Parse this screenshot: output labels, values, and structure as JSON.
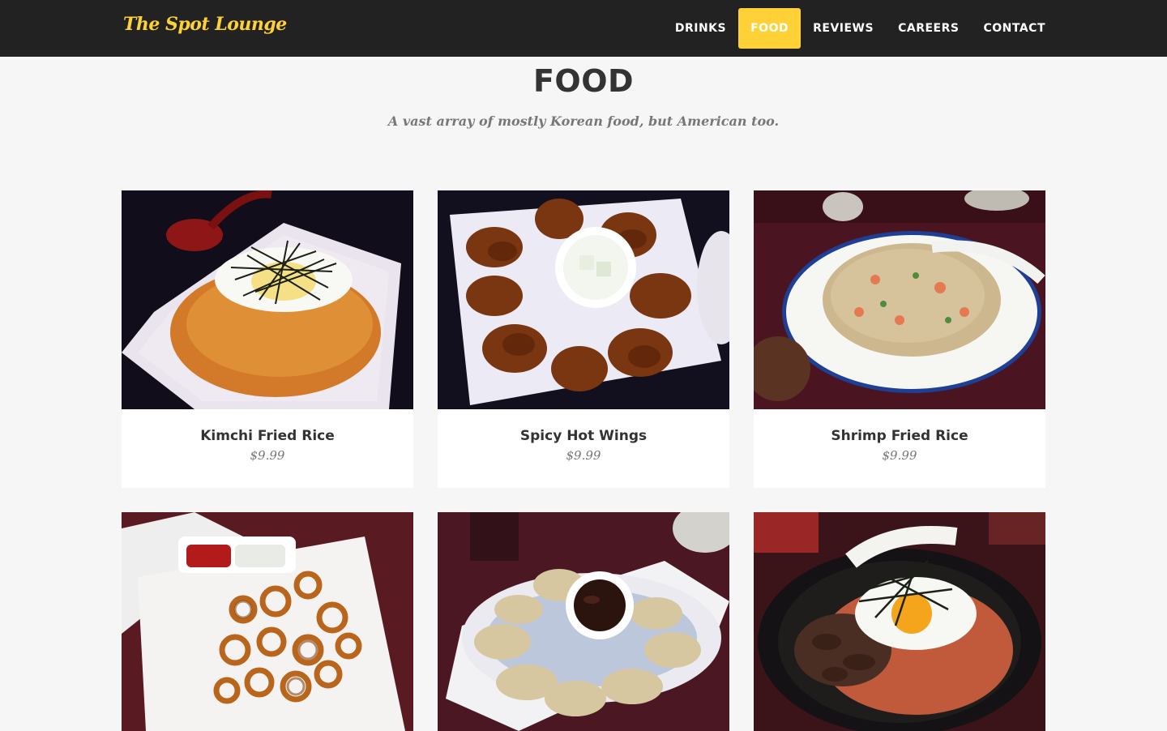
{
  "brand": {
    "name": "The Spot Lounge",
    "color": "#fed136"
  },
  "nav": {
    "items": [
      {
        "label": "DRINKS",
        "active": false
      },
      {
        "label": "FOOD",
        "active": true
      },
      {
        "label": "REVIEWS",
        "active": false
      },
      {
        "label": "CAREERS",
        "active": false
      },
      {
        "label": "CONTACT",
        "active": false
      }
    ]
  },
  "section": {
    "title": "FOOD",
    "subtitle": "A vast array of mostly Korean food, but American too."
  },
  "menu": {
    "items": [
      {
        "name": "Kimchi Fried Rice",
        "price": "$9.99",
        "icon": "kimchi-fried-rice-photo"
      },
      {
        "name": "Spicy Hot Wings",
        "price": "$9.99",
        "icon": "hot-wings-photo"
      },
      {
        "name": "Shrimp Fried Rice",
        "price": "$9.99",
        "icon": "shrimp-fried-rice-photo"
      },
      {
        "name": "",
        "price": "",
        "icon": "curly-fries-photo"
      },
      {
        "name": "",
        "price": "",
        "icon": "dumplings-photo"
      },
      {
        "name": "",
        "price": "",
        "icon": "bibimbap-photo"
      }
    ]
  },
  "colors": {
    "nav_bg": "#222222",
    "accent": "#fed136",
    "page_bg": "#f6f6f6"
  }
}
